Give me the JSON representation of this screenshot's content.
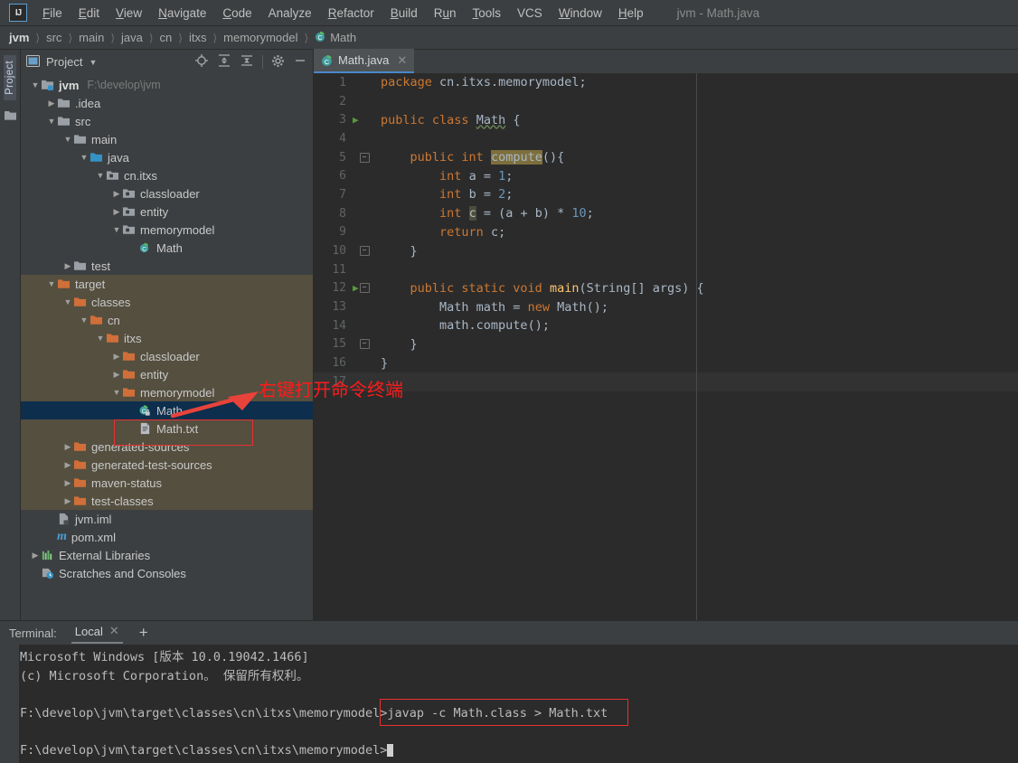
{
  "window": {
    "title": "jvm - Math.java",
    "logo": "IJ"
  },
  "menubar": {
    "items": [
      {
        "label": "File"
      },
      {
        "label": "Edit"
      },
      {
        "label": "View"
      },
      {
        "label": "Navigate"
      },
      {
        "label": "Code"
      },
      {
        "label": "Analyze"
      },
      {
        "label": "Refactor"
      },
      {
        "label": "Build"
      },
      {
        "label": "Run"
      },
      {
        "label": "Tools"
      },
      {
        "label": "VCS"
      },
      {
        "label": "Window"
      },
      {
        "label": "Help"
      }
    ]
  },
  "breadcrumb": {
    "separator": "〉",
    "items": [
      {
        "label": "jvm"
      },
      {
        "label": "src"
      },
      {
        "label": "main"
      },
      {
        "label": "java"
      },
      {
        "label": "cn"
      },
      {
        "label": "itxs"
      },
      {
        "label": "memorymodel"
      },
      {
        "label": "Math",
        "icon": "java-class-icon"
      }
    ]
  },
  "left_strip": {
    "tab_label": "Project",
    "folder_icon": "folder-icon"
  },
  "project_panel": {
    "title": "Project",
    "dropdown_icon": "chevron-down-icon",
    "toolbar": [
      {
        "name": "locate-icon"
      },
      {
        "name": "expand-all-icon"
      },
      {
        "name": "collapse-all-icon"
      },
      {
        "name": "settings-gear-icon"
      },
      {
        "name": "minimize-icon"
      }
    ],
    "tree": [
      {
        "label": "jvm",
        "note": "F:\\develop\\jvm",
        "indent": 0,
        "arrow": "down",
        "icon": "module-icon",
        "bold": true
      },
      {
        "label": ".idea",
        "indent": 1,
        "arrow": "right",
        "icon": "folder-icon"
      },
      {
        "label": "src",
        "indent": 1,
        "arrow": "down",
        "icon": "folder-icon"
      },
      {
        "label": "main",
        "indent": 2,
        "arrow": "down",
        "icon": "folder-icon"
      },
      {
        "label": "java",
        "indent": 3,
        "arrow": "down",
        "icon": "source-folder-icon"
      },
      {
        "label": "cn.itxs",
        "indent": 4,
        "arrow": "down",
        "icon": "package-icon"
      },
      {
        "label": "classloader",
        "indent": 5,
        "arrow": "right",
        "icon": "package-icon"
      },
      {
        "label": "entity",
        "indent": 5,
        "arrow": "right",
        "icon": "package-icon"
      },
      {
        "label": "memorymodel",
        "indent": 5,
        "arrow": "down",
        "icon": "package-icon"
      },
      {
        "label": "Math",
        "indent": 6,
        "arrow": "none",
        "icon": "java-class-icon"
      },
      {
        "label": "test",
        "indent": 2,
        "arrow": "right",
        "icon": "folder-icon"
      },
      {
        "label": "target",
        "indent": 1,
        "arrow": "down",
        "icon": "folder-orange-icon",
        "state": "target"
      },
      {
        "label": "classes",
        "indent": 2,
        "arrow": "down",
        "icon": "folder-orange-icon",
        "state": "target"
      },
      {
        "label": "cn",
        "indent": 3,
        "arrow": "down",
        "icon": "folder-orange-icon",
        "state": "target"
      },
      {
        "label": "itxs",
        "indent": 4,
        "arrow": "down",
        "icon": "folder-orange-icon",
        "state": "target"
      },
      {
        "label": "classloader",
        "indent": 5,
        "arrow": "right",
        "icon": "folder-orange-icon",
        "state": "target"
      },
      {
        "label": "entity",
        "indent": 5,
        "arrow": "right",
        "icon": "folder-orange-icon",
        "state": "target"
      },
      {
        "label": "memorymodel",
        "indent": 5,
        "arrow": "down",
        "icon": "folder-orange-icon",
        "state": "target"
      },
      {
        "label": "Math",
        "indent": 6,
        "arrow": "none",
        "icon": "java-class-locked-icon",
        "state": "selected"
      },
      {
        "label": "Math.txt",
        "indent": 6,
        "arrow": "none",
        "icon": "text-file-icon",
        "state": "target"
      },
      {
        "label": "generated-sources",
        "indent": 2,
        "arrow": "right",
        "icon": "folder-orange-icon",
        "state": "target"
      },
      {
        "label": "generated-test-sources",
        "indent": 2,
        "arrow": "right",
        "icon": "folder-orange-icon",
        "state": "target"
      },
      {
        "label": "maven-status",
        "indent": 2,
        "arrow": "right",
        "icon": "folder-orange-icon",
        "state": "target"
      },
      {
        "label": "test-classes",
        "indent": 2,
        "arrow": "right",
        "icon": "folder-orange-icon",
        "state": "target"
      },
      {
        "label": "jvm.iml",
        "indent": 1,
        "arrow": "none",
        "icon": "iml-file-icon"
      },
      {
        "label": "pom.xml",
        "indent": 1,
        "arrow": "none",
        "icon": "maven-icon"
      },
      {
        "label": "External Libraries",
        "indent": 0,
        "arrow": "right",
        "icon": "libraries-icon"
      },
      {
        "label": "Scratches and Consoles",
        "indent": 0,
        "arrow": "none",
        "icon": "scratches-icon"
      }
    ]
  },
  "editor": {
    "tab": {
      "label": "Math.java",
      "icon": "java-class-icon",
      "close_icon": "close-icon"
    },
    "lines": [
      {
        "n": 1,
        "html": "<span class=\"kw\">package</span> <span class=\"pl\">cn.itxs.memorymodel;</span>"
      },
      {
        "n": 2,
        "html": ""
      },
      {
        "n": 3,
        "html": "<span class=\"kw\">public class</span> <span class=\"cls wavy\">Math</span> <span class=\"pl\">{</span>",
        "run": true
      },
      {
        "n": 4,
        "html": ""
      },
      {
        "n": 5,
        "html": "    <span class=\"kw\">public int</span> <span class=\"hl\">compute</span><span class=\"pl\">(){</span>",
        "fold": "open"
      },
      {
        "n": 6,
        "html": "        <span class=\"kw\">int</span> <span class=\"pl\">a = </span><span class=\"num\">1</span><span class=\"pl\">;</span>"
      },
      {
        "n": 7,
        "html": "        <span class=\"kw\">int</span> <span class=\"pl\">b = </span><span class=\"num\">2</span><span class=\"pl\">;</span>"
      },
      {
        "n": 8,
        "html": "        <span class=\"kw\">int</span> <span class=\"hlc\">c</span><span class=\"pl\"> = (a + b) * </span><span class=\"num\">10</span><span class=\"pl\">;</span>"
      },
      {
        "n": 9,
        "html": "        <span class=\"kw\">return</span> <span class=\"pl\">c;</span>"
      },
      {
        "n": 10,
        "html": "    <span class=\"pl\">}</span>",
        "fold": "close"
      },
      {
        "n": 11,
        "html": ""
      },
      {
        "n": 12,
        "html": "    <span class=\"kw\">public static void</span> <span class=\"fn\">main</span><span class=\"pl\">(String[] args) {</span>",
        "run": true,
        "fold": "open"
      },
      {
        "n": 13,
        "html": "        <span class=\"pl\">Math math = </span><span class=\"kw\">new</span> <span class=\"pl\">Math();</span>"
      },
      {
        "n": 14,
        "html": "        <span class=\"pl\">math.compute();</span>"
      },
      {
        "n": 15,
        "html": "    <span class=\"pl\">}</span>",
        "fold": "close"
      },
      {
        "n": 16,
        "html": "<span class=\"pl\">}</span>"
      },
      {
        "n": 17,
        "html": "",
        "cursor": true
      }
    ]
  },
  "annotation": {
    "text": "右键打开命令终端",
    "color": "#ff1a1a",
    "arrow_name": "red-arrow-pointer",
    "boxes": [
      "math-txt-highlight-box",
      "javap-command-highlight-box"
    ]
  },
  "terminal": {
    "label": "Terminal:",
    "tab": "Local",
    "close_icon": "close-icon",
    "add_icon": "add-tab-icon",
    "lines": [
      {
        "text": "Microsoft Windows [版本 10.0.19042.1466]"
      },
      {
        "text": "(c) Microsoft Corporation。 保留所有权利。"
      },
      {
        "text": ""
      },
      {
        "prompt": "F:\\develop\\jvm\\target\\classes\\cn\\itxs\\memorymodel>",
        "command": "javap -c Math.class > Math.txt"
      },
      {
        "text": ""
      },
      {
        "prompt": "F:\\develop\\jvm\\target\\classes\\cn\\itxs\\memorymodel>",
        "command": "",
        "cursor": true
      }
    ]
  },
  "colors": {
    "panel_bg": "#3c3f41",
    "editor_bg": "#2b2b2b",
    "selection": "#0d2e4d",
    "target_folder_bg": "#544f3f",
    "accent_blue": "#4a88c7",
    "annotation_red": "#ff1a1a"
  }
}
